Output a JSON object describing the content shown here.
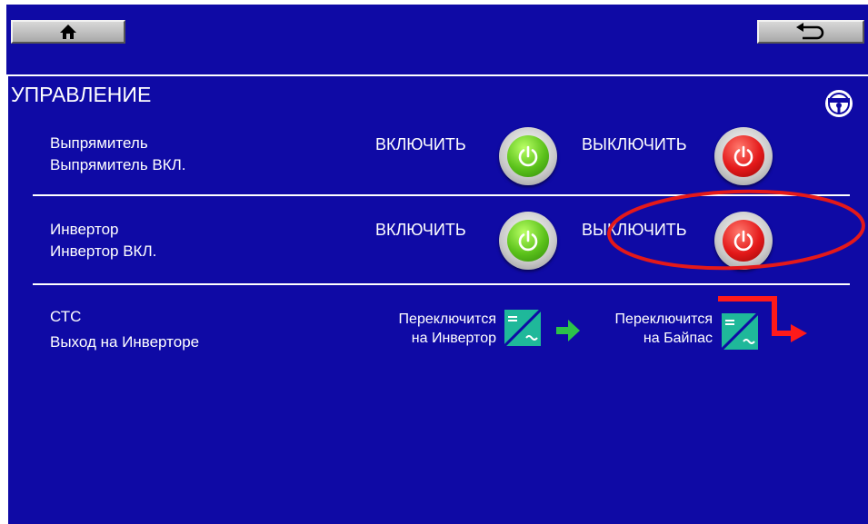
{
  "header": {
    "home_icon": "home-icon",
    "back_icon": "return-arrow-icon"
  },
  "section": {
    "title": "УПРАВЛЕНИЕ",
    "corner_icon": "steering-wheel-icon"
  },
  "rows": [
    {
      "name": "Выпрямитель",
      "status": "Выпрямитель ВКЛ.",
      "on_label": "ВКЛЮЧИТЬ",
      "off_label": "ВЫКЛЮЧИТЬ"
    },
    {
      "name": "Инвертор",
      "status": "Инвертор ВКЛ.",
      "on_label": "ВКЛЮЧИТЬ",
      "off_label": "ВЫКЛЮЧИТЬ"
    }
  ],
  "switch_row": {
    "name": "СТС",
    "status": "Выход на Инверторе",
    "to_inverter_line1": "Переключится",
    "to_inverter_line2": "на Инвертор",
    "to_bypass_line1": "Переключится",
    "to_bypass_line2": "на Байпас"
  },
  "colors": {
    "background": "#0f0aa5",
    "on_button": "#5cc21b",
    "off_button": "#e4191a",
    "highlight_annotation": "#e4191a",
    "converter_icon": "#1fb89a"
  }
}
